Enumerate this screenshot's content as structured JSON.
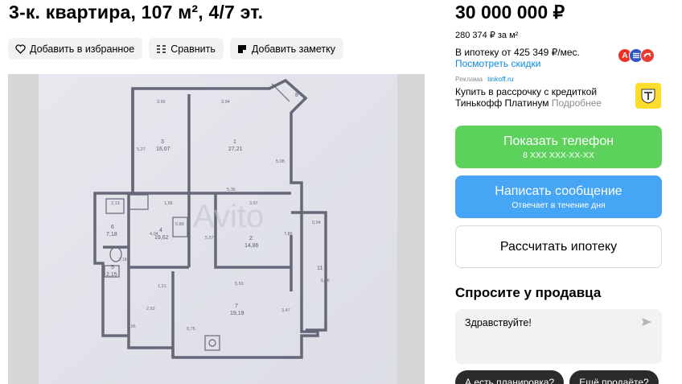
{
  "listing": {
    "title": "3-к. квартира, 107 м², 4/7 эт.",
    "price": "30 000 000 ₽",
    "price_per_m2": "280 374 ₽ за м²",
    "mortgage_text": "В ипотеку от 425 349 ₽/мес.",
    "discounts_link": "Посмотреть скидки"
  },
  "actions": [
    {
      "label": "Добавить в избранное",
      "icon": "heart-icon"
    },
    {
      "label": "Сравнить",
      "icon": "compare-icon"
    },
    {
      "label": "Добавить заметку",
      "icon": "note-icon"
    }
  ],
  "banks": [
    {
      "letter": "А",
      "color": "#ef3124",
      "icon": "alfa-bank-icon"
    },
    {
      "letter": "",
      "color": "#2d57c8",
      "icon": "bank-icon"
    },
    {
      "letter": "",
      "color": "#e83d35",
      "icon": "bank-icon"
    }
  ],
  "ad": {
    "label": "Реклама",
    "link": "tinkoff.ru",
    "text": "Купить в рассрочку с кредиткой Тинькофф Платинум",
    "more": "Подробнее"
  },
  "buttons": {
    "phone_label": "Показать телефон",
    "phone_number": "8 XXX XXX-XX-XX",
    "message_label": "Написать сообщение",
    "message_sub": "Отвечает в течение дня",
    "mortgage_label": "Рассчитать ипотеку"
  },
  "ask": {
    "title": "Спросите у продавца",
    "message": "Здравствуйте!",
    "chips": [
      "А есть планировка?",
      "Ещё продаёте?"
    ]
  },
  "floorplan": {
    "watermark": "Avito",
    "rooms": [
      {
        "num": "3",
        "area": "16,07"
      },
      {
        "num": "1",
        "area": "27,21"
      },
      {
        "num": "6",
        "area": "7,18"
      },
      {
        "num": "4",
        "area": "19,62"
      },
      {
        "num": "2",
        "area": "14,86"
      },
      {
        "num": "5",
        "area": "2,15"
      },
      {
        "num": "7",
        "area": "19,19"
      },
      {
        "num": "8",
        "area": ""
      },
      {
        "num": "11",
        "area": ""
      }
    ],
    "dims": [
      "3,66",
      "3,94",
      "5,27",
      "5,08",
      "5,36",
      "2,13",
      "1,56",
      "3,67",
      "4,04",
      "0,89",
      "5,57",
      "0,94",
      "7,86",
      "2,18",
      "5,59",
      "5,36",
      "1,21",
      "2,62",
      "3,47",
      "0,96",
      "0,75"
    ]
  },
  "colors": {
    "green": "#5cd15c",
    "blue": "#47a5f5",
    "link": "#0a8bd8"
  }
}
